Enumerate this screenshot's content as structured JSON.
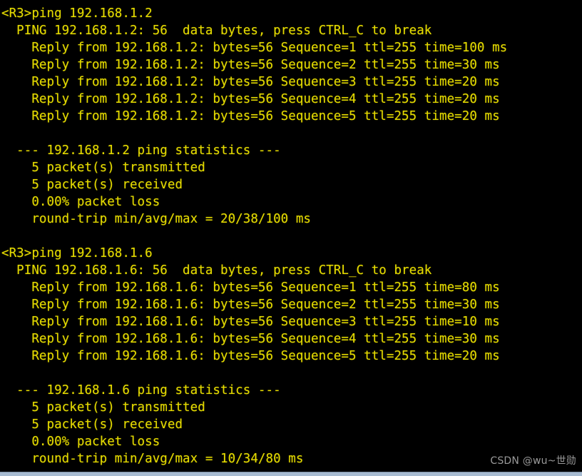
{
  "terminal": {
    "device_prompt": "<R3>",
    "foreground_color": "#e3d900",
    "background_color": "#000000",
    "lines": [
      "<R3>ping 192.168.1.2",
      "  PING 192.168.1.2: 56  data bytes, press CTRL_C to break",
      "    Reply from 192.168.1.2: bytes=56 Sequence=1 ttl=255 time=100 ms",
      "    Reply from 192.168.1.2: bytes=56 Sequence=2 ttl=255 time=30 ms",
      "    Reply from 192.168.1.2: bytes=56 Sequence=3 ttl=255 time=20 ms",
      "    Reply from 192.168.1.2: bytes=56 Sequence=4 ttl=255 time=20 ms",
      "    Reply from 192.168.1.2: bytes=56 Sequence=5 ttl=255 time=20 ms",
      "",
      "  --- 192.168.1.2 ping statistics ---",
      "    5 packet(s) transmitted",
      "    5 packet(s) received",
      "    0.00% packet loss",
      "    round-trip min/avg/max = 20/38/100 ms",
      "",
      "<R3>ping 192.168.1.6",
      "  PING 192.168.1.6: 56  data bytes, press CTRL_C to break",
      "    Reply from 192.168.1.6: bytes=56 Sequence=1 ttl=255 time=80 ms",
      "    Reply from 192.168.1.6: bytes=56 Sequence=2 ttl=255 time=30 ms",
      "    Reply from 192.168.1.6: bytes=56 Sequence=3 ttl=255 time=10 ms",
      "    Reply from 192.168.1.6: bytes=56 Sequence=4 ttl=255 time=30 ms",
      "    Reply from 192.168.1.6: bytes=56 Sequence=5 ttl=255 time=20 ms",
      "",
      "  --- 192.168.1.6 ping statistics ---",
      "    5 packet(s) transmitted",
      "    5 packet(s) received",
      "    0.00% packet loss",
      "    round-trip min/avg/max = 10/34/80 ms"
    ],
    "ping_sessions": [
      {
        "command": "ping 192.168.1.2",
        "target": "192.168.1.2",
        "data_bytes": "56",
        "break_hint": "press CTRL_C to break",
        "replies": [
          {
            "sequence": "1",
            "bytes": "56",
            "ttl": "255",
            "time_ms": "100"
          },
          {
            "sequence": "2",
            "bytes": "56",
            "ttl": "255",
            "time_ms": "30"
          },
          {
            "sequence": "3",
            "bytes": "56",
            "ttl": "255",
            "time_ms": "20"
          },
          {
            "sequence": "4",
            "bytes": "56",
            "ttl": "255",
            "time_ms": "20"
          },
          {
            "sequence": "5",
            "bytes": "56",
            "ttl": "255",
            "time_ms": "20"
          }
        ],
        "statistics": {
          "header": "--- 192.168.1.2 ping statistics ---",
          "transmitted": "5 packet(s) transmitted",
          "received": "5 packet(s) received",
          "loss": "0.00% packet loss",
          "round_trip": "round-trip min/avg/max = 20/38/100 ms",
          "min_ms": "20",
          "avg_ms": "38",
          "max_ms": "100"
        }
      },
      {
        "command": "ping 192.168.1.6",
        "target": "192.168.1.6",
        "data_bytes": "56",
        "break_hint": "press CTRL_C to break",
        "replies": [
          {
            "sequence": "1",
            "bytes": "56",
            "ttl": "255",
            "time_ms": "80"
          },
          {
            "sequence": "2",
            "bytes": "56",
            "ttl": "255",
            "time_ms": "30"
          },
          {
            "sequence": "3",
            "bytes": "56",
            "ttl": "255",
            "time_ms": "10"
          },
          {
            "sequence": "4",
            "bytes": "56",
            "ttl": "255",
            "time_ms": "30"
          },
          {
            "sequence": "5",
            "bytes": "56",
            "ttl": "255",
            "time_ms": "20"
          }
        ],
        "statistics": {
          "header": "--- 192.168.1.6 ping statistics ---",
          "transmitted": "5 packet(s) transmitted",
          "received": "5 packet(s) received",
          "loss": "0.00% packet loss",
          "round_trip": "round-trip min/avg/max = 10/34/80 ms",
          "min_ms": "10",
          "avg_ms": "34",
          "max_ms": "80"
        }
      }
    ]
  },
  "watermark": {
    "text": "CSDN @wu~世勋",
    "color": "#9a9a9a"
  },
  "bottom_bar": {
    "color": "#a8bcd2"
  }
}
